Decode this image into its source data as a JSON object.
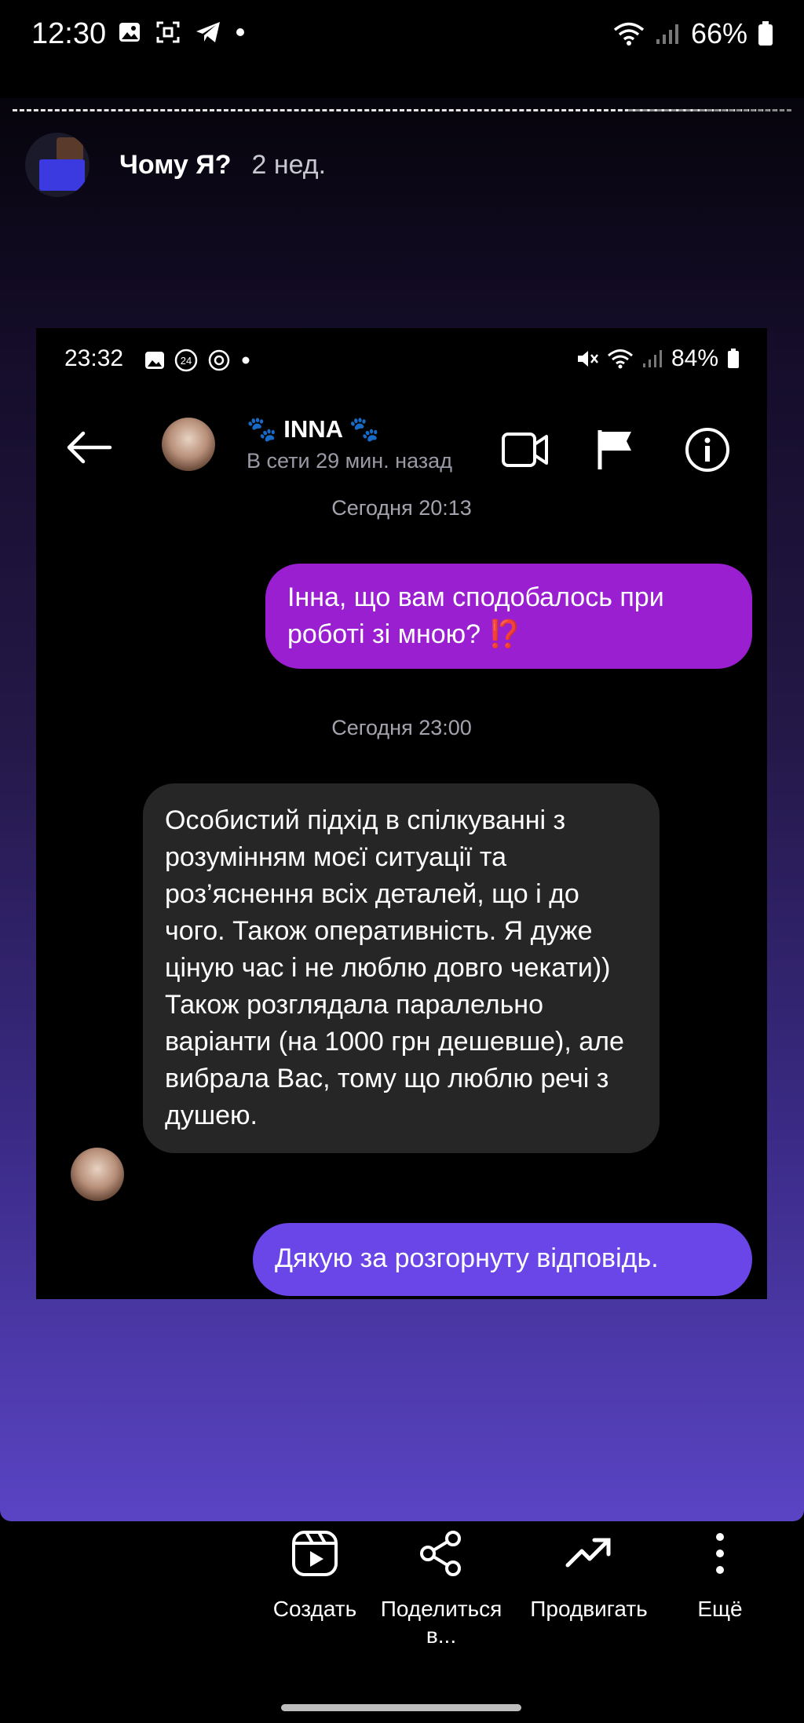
{
  "statusbar": {
    "time": "12:30",
    "battery": "66%",
    "icons": [
      "gallery-icon",
      "screenshot-icon",
      "telegram-icon",
      "dot-icon"
    ],
    "right_icons": [
      "wifi-icon",
      "signal-icon",
      "battery-icon"
    ]
  },
  "story": {
    "title": "Чому Я?",
    "age": "2 нед."
  },
  "screenshot": {
    "statusbar": {
      "time": "23:32",
      "battery": "84%",
      "icons": [
        "gallery-icon",
        "badge-24-icon",
        "sync-icon",
        "dot-icon"
      ],
      "right_icons": [
        "mute-icon",
        "wifi-icon",
        "signal-icon",
        "battery-icon"
      ]
    },
    "header": {
      "name": "🐾 INNA 🐾",
      "status": "В сети 29 мин. назад"
    },
    "messages": {
      "date1": "Сегодня 20:13",
      "out1_text": "Інна, що вам сподобалось при роботі зі мною? ",
      "out1_emoji": "⁉️",
      "date2": "Сегодня 23:00",
      "in1": "Особистий підхід в спілкуванні з розумінням моєї ситуації та роз’яснення всіх деталей, що і до чого. Також оперативність. Я дуже ціную час і не люблю довго чекати))\nТакож розглядала паралельно варіанти (на 1000 грн дешевше), але вибрала Вас, тому що люблю речі з душею.",
      "out2": "Дякую за розгорнуту відповідь."
    }
  },
  "actions": {
    "create": "Создать",
    "share": "Поделиться в...",
    "promote": "Продвигать",
    "more": "Ещё"
  },
  "colors": {
    "outgoing_bubble": "#9a1fd0",
    "outgoing_bubble_2": "#6a45e8",
    "incoming_bubble": "#262626"
  }
}
